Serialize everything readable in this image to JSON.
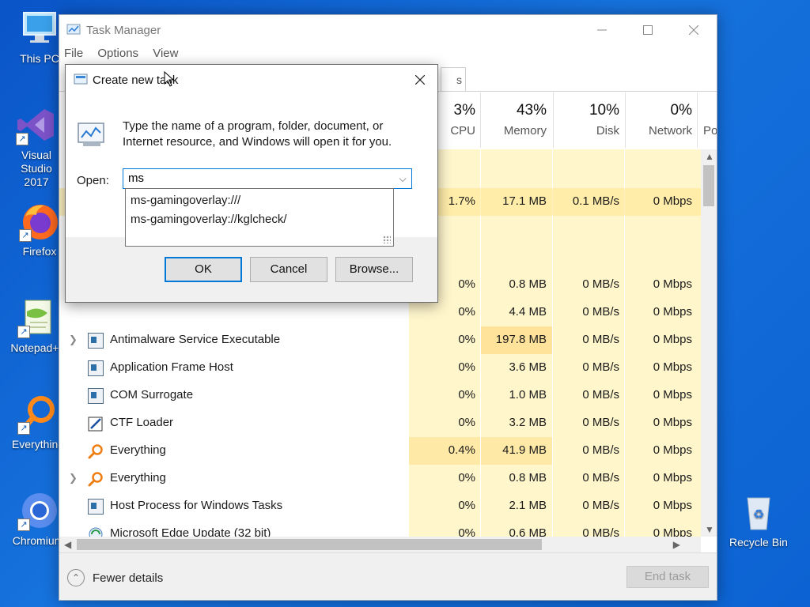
{
  "desktop": {
    "icons": [
      {
        "label": "This PC"
      },
      {
        "label": "Visual Studio\n2017"
      },
      {
        "label": "Firefox"
      },
      {
        "label": "Notepad++"
      },
      {
        "label": "Everything"
      },
      {
        "label": "Chromium"
      },
      {
        "label": "Recycle Bin"
      }
    ]
  },
  "task_manager": {
    "title": "Task Manager",
    "menu": [
      "File",
      "Options",
      "View"
    ],
    "tab_fragment": "s",
    "columns": [
      {
        "pct": "3%",
        "name": "CPU"
      },
      {
        "pct": "43%",
        "name": "Memory"
      },
      {
        "pct": "10%",
        "name": "Disk"
      },
      {
        "pct": "0%",
        "name": "Network"
      },
      {
        "pct": "",
        "name": "Po"
      }
    ],
    "partial_rows": [
      {
        "cpu": "1.7%",
        "memory": "17.1 MB",
        "disk": "0.1 MB/s",
        "network": "0 Mbps"
      },
      {
        "cpu": "0%",
        "memory": "0.8 MB",
        "disk": "0 MB/s",
        "network": "0 Mbps"
      },
      {
        "cpu": "0%",
        "memory": "4.4 MB",
        "disk": "0 MB/s",
        "network": "0 Mbps"
      }
    ],
    "rows": [
      {
        "name": "Antimalware Service Executable",
        "cpu": "0%",
        "memory": "197.8 MB",
        "disk": "0 MB/s",
        "network": "0 Mbps"
      },
      {
        "name": "Application Frame Host",
        "cpu": "0%",
        "memory": "3.6 MB",
        "disk": "0 MB/s",
        "network": "0 Mbps"
      },
      {
        "name": "COM Surrogate",
        "cpu": "0%",
        "memory": "1.0 MB",
        "disk": "0 MB/s",
        "network": "0 Mbps"
      },
      {
        "name": "CTF Loader",
        "cpu": "0%",
        "memory": "3.2 MB",
        "disk": "0 MB/s",
        "network": "0 Mbps"
      },
      {
        "name": "Everything",
        "cpu": "0.4%",
        "memory": "41.9 MB",
        "disk": "0 MB/s",
        "network": "0 Mbps"
      },
      {
        "name": "Everything",
        "cpu": "0%",
        "memory": "0.8 MB",
        "disk": "0 MB/s",
        "network": "0 Mbps"
      },
      {
        "name": "Host Process for Windows Tasks",
        "cpu": "0%",
        "memory": "2.1 MB",
        "disk": "0 MB/s",
        "network": "0 Mbps"
      },
      {
        "name": "Microsoft Edge Update (32 bit)",
        "cpu": "0%",
        "memory": "0.6 MB",
        "disk": "0 MB/s",
        "network": "0 Mbps"
      }
    ],
    "fewer_details": "Fewer details",
    "end_task": "End task"
  },
  "dialog": {
    "title": "Create new task",
    "description": "Type the name of a program, folder, document, or Internet resource, and Windows will open it for you.",
    "open_label": "Open:",
    "open_value": "ms",
    "suggestions": [
      "ms-gamingoverlay:///",
      "ms-gamingoverlay://kglcheck/"
    ],
    "ok": "OK",
    "cancel": "Cancel",
    "browse": "Browse..."
  },
  "colors": {
    "desktop": "#1672dd",
    "accent": "#0078d7",
    "heat_light": "#fff6cc",
    "heat_medium": "#ffeaa0"
  }
}
